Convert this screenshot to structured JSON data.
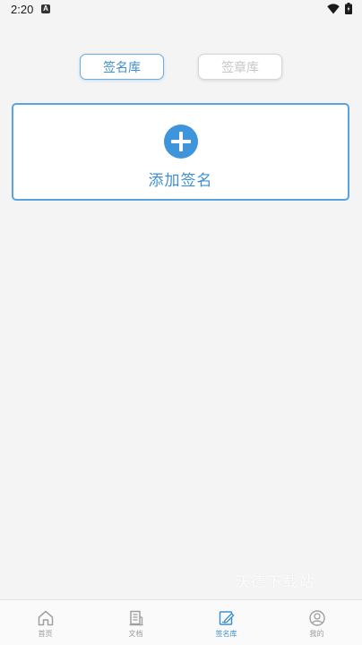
{
  "status_bar": {
    "time": "2:20",
    "notification_glyph": "A"
  },
  "tabs": [
    {
      "label": "签名库",
      "active": true
    },
    {
      "label": "签章库",
      "active": false
    }
  ],
  "add_card": {
    "label": "添加签名"
  },
  "watermark": "沃德下载站",
  "bottom_nav": {
    "items": [
      {
        "label": "首页",
        "icon": "home-icon",
        "active": false
      },
      {
        "label": "文档",
        "icon": "document-icon",
        "active": false
      },
      {
        "label": "签名库",
        "icon": "signature-icon",
        "active": true
      },
      {
        "label": "我的",
        "icon": "user-icon",
        "active": false
      }
    ]
  },
  "colors": {
    "accent": "#3e95dc",
    "background": "#f4f4f4",
    "inactive": "#9a9a9a"
  }
}
